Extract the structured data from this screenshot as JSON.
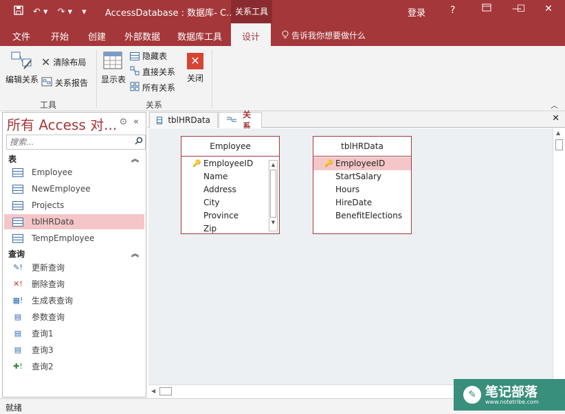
{
  "titlebar": {
    "save_icon": "save-icon",
    "undo_icon": "undo-icon",
    "redo_icon": "redo-icon",
    "title": "AccessDatabase : 数据库- C...",
    "context_tab": "关系工具",
    "login": "登录",
    "help": "?",
    "minimize": "—",
    "restore": "☐",
    "close": "✕"
  },
  "tabs": {
    "file": "文件",
    "home": "开始",
    "create": "创建",
    "external": "外部数据",
    "dbtools": "数据库工具",
    "design": "设计",
    "tellme": "告诉我你想要做什么"
  },
  "ribbon": {
    "edit_relationships": "编辑关系",
    "clear_layout": "清除布局",
    "relationship_report": "关系报告",
    "tools_group": "工具",
    "show_table": "显示表",
    "hide_table": "隐藏表",
    "direct_relationships": "直接关系",
    "all_relationships": "所有关系",
    "close": "关闭",
    "relationships_group": "关系"
  },
  "nav": {
    "title": "所有 Access 对...",
    "search_placeholder": "搜索...",
    "tables_header": "表",
    "tables": [
      {
        "label": "Employee"
      },
      {
        "label": "NewEmployee"
      },
      {
        "label": "Projects"
      },
      {
        "label": "tblHRData"
      },
      {
        "label": "TempEmployee"
      }
    ],
    "queries_header": "查询",
    "queries": [
      {
        "label": "更新查询"
      },
      {
        "label": "删除查询"
      },
      {
        "label": "生成表查询"
      },
      {
        "label": "参数查询"
      },
      {
        "label": "查询1"
      },
      {
        "label": "查询3"
      },
      {
        "label": "查询2"
      }
    ]
  },
  "doctabs": {
    "tab1": "tblHRData",
    "tab2": "关系"
  },
  "employee_table": {
    "title": "Employee",
    "fields": [
      "EmployeeID",
      "Name",
      "Address",
      "City",
      "Province",
      "Zip"
    ]
  },
  "hr_table": {
    "title": "tblHRData",
    "fields": [
      "EmployeeID",
      "StartSalary",
      "Hours",
      "HireDate",
      "BenefitElections"
    ]
  },
  "status": {
    "text": "就绪"
  },
  "watermark": {
    "line1": "笔记部落",
    "line2": "www.notetribe.com"
  }
}
